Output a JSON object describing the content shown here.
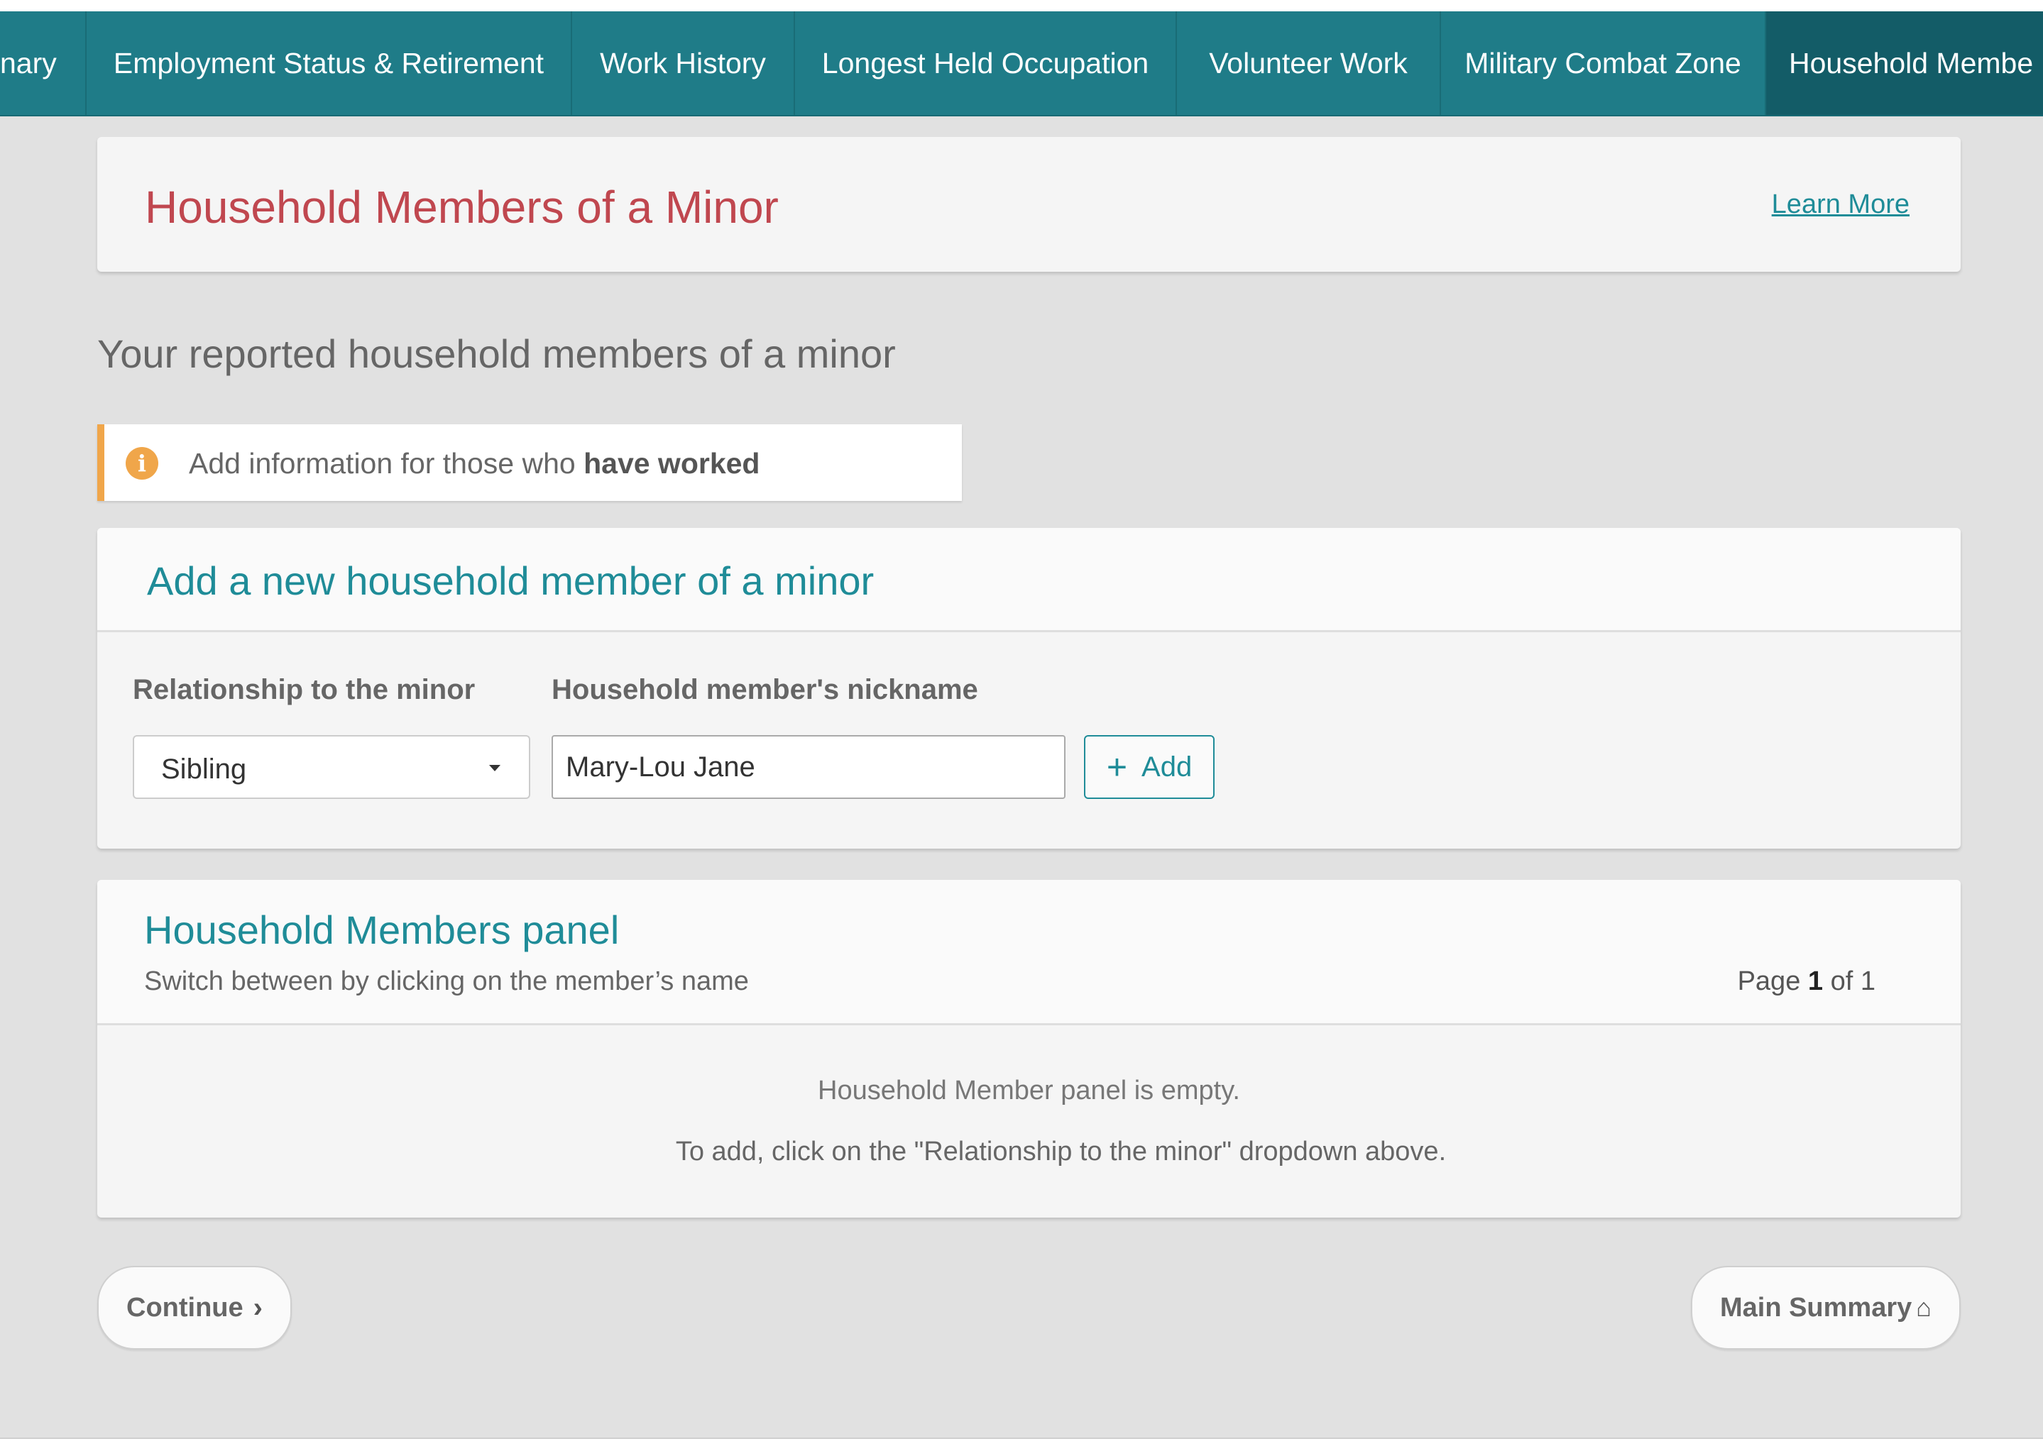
{
  "tabs": [
    {
      "label": "nary"
    },
    {
      "label": "Employment Status & Retirement"
    },
    {
      "label": "Work History"
    },
    {
      "label": "Longest Held Occupation"
    },
    {
      "label": "Volunteer Work"
    },
    {
      "label": "Military Combat Zone"
    },
    {
      "label": "Household Membe"
    }
  ],
  "header": {
    "title": "Household Members of a Minor",
    "learn_more": "Learn More"
  },
  "section_heading": "Your reported household members of a minor",
  "info": {
    "icon": "i",
    "text_prefix": "Add information for those who ",
    "text_bold": "have worked"
  },
  "add_panel": {
    "title": "Add a new household member of a minor",
    "relationship_label": "Relationship to the minor",
    "relationship_value": "Sibling",
    "nickname_label": "Household member's nickname",
    "nickname_value": "Mary-Lou Jane",
    "add_label": "Add",
    "add_icon": "+"
  },
  "members_panel": {
    "title": "Household Members panel",
    "subtitle": "Switch between by clicking on the member’s name",
    "page_prefix": "Page",
    "page_current": "1",
    "page_of": "of",
    "page_total": "1",
    "empty_line1": "Household Member panel is empty.",
    "empty_line2": "To add, click on the \"Relationship to the minor\" dropdown above."
  },
  "footer": {
    "continue_label": "Continue",
    "continue_icon": "›",
    "main_summary_label": "Main Summary",
    "home_icon": "⌂"
  }
}
